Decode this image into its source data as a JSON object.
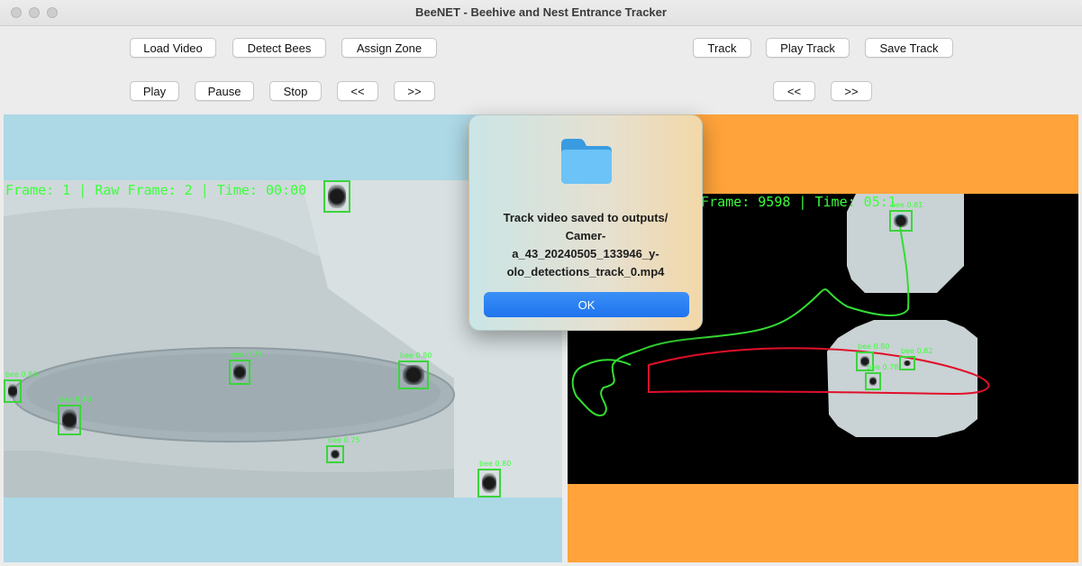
{
  "window": {
    "title": "BeeNET - Beehive and Nest Entrance Tracker"
  },
  "toolbar": {
    "load_video": "Load Video",
    "detect_bees": "Detect Bees",
    "assign_zone": "Assign Zone",
    "play": "Play",
    "pause": "Pause",
    "stop": "Stop",
    "prev": "<<",
    "next": ">>",
    "track": "Track",
    "play_track": "Play Track",
    "save_track": "Save Track",
    "track_prev": "<<",
    "track_next": ">>"
  },
  "left_view": {
    "overlay": "Frame: 1  |  Raw Frame: 2  |  Time: 00:00",
    "detections": [
      {
        "label": "bee 0.80"
      },
      {
        "label": "bee 0.80"
      },
      {
        "label": "bee 0.73"
      },
      {
        "label": "bee 0.80"
      },
      {
        "label": "bee 0.75"
      },
      {
        "label": "bee 0.80"
      },
      {
        "label": "bee 0.80"
      }
    ]
  },
  "right_view": {
    "overlay": "y Frame: 9598  |  Time: 05:1",
    "detections": [
      {
        "label": "bee 0.81"
      },
      {
        "label": "bee 0.80"
      },
      {
        "label": "bee 0.78"
      },
      {
        "label": "bee 0.82"
      }
    ]
  },
  "dialog": {
    "icon": "folder-icon",
    "message_lines": [
      "Track video saved to outputs/",
      "Camer-",
      "a_43_20240505_133946_y-",
      "olo_detections_track_0.mp4"
    ],
    "ok_label": "OK"
  },
  "colors": {
    "left_panel_bg": "#add8e6",
    "right_panel_bg": "#ffa33a",
    "overlay_green": "#3cff3c",
    "track_green": "#33dd33",
    "zone_red": "#e0102a",
    "ok_blue": "#2a82f2"
  }
}
